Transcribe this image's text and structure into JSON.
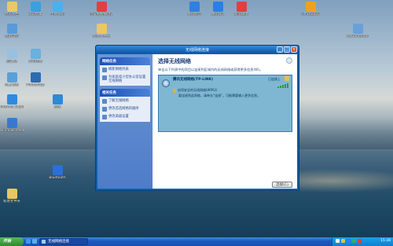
{
  "desktop": {
    "icons": [
      {
        "label": "我的文档",
        "color": "#e8c86a"
      },
      {
        "label": "360杀毒",
        "color": "#3aa0e0"
      },
      {
        "label": "上网导航",
        "color": "#4ab0f0"
      },
      {
        "label": "迅雷看看播放器",
        "color": "#e04040"
      },
      {
        "label": "暴风影音",
        "color": "#3080e0"
      },
      {
        "label": "腾讯QQ",
        "color": "#2a7ee8"
      },
      {
        "label": "新浪微博",
        "color": "#e04040"
      },
      {
        "label": "Office2007",
        "color": "#f0a020"
      },
      {
        "label": "我的电脑",
        "color": "#5a9ad8"
      },
      {
        "label": "新建文件夹",
        "color": "#e8c860"
      },
      {
        "label": "MyComputer",
        "color": "#6aa0d8"
      },
      {
        "label": "回收站",
        "color": "#9ac0e0"
      },
      {
        "label": "宽带连接",
        "color": "#6ab0e0"
      },
      {
        "label": "Internet Explorer",
        "color": "#2f8adf"
      },
      {
        "label": "网上邻居",
        "color": "#5aa0d8"
      },
      {
        "label": "Windows Media Player",
        "color": "#3a78d0"
      },
      {
        "label": "Photoshop",
        "color": "#2b6cb0"
      },
      {
        "label": "迅雷",
        "color": "#2c8ad8"
      },
      {
        "label": "新建文件夹",
        "color": "#e8c860"
      },
      {
        "label": "Bluetooth",
        "color": "#2a70d8"
      }
    ]
  },
  "window": {
    "title": "无线网络连接",
    "buttons": {
      "min": "_",
      "max": "□",
      "close": "×"
    },
    "sidebar": {
      "panels": [
        {
          "header": "网络任务",
          "items": [
            "刷新网络列表",
            "为家庭或小型办公室设置无线网络"
          ]
        },
        {
          "header": "相关任务",
          "items": [
            "了解无线网络",
            "更改首选网络的顺序",
            "更改高级设置"
          ]
        }
      ]
    },
    "main": {
      "heading": "选择无线网络",
      "description": "单击以下列表中的项目以连接到区域内的无线网络或获得更多信息(W)。",
      "network": {
        "name": "腾讯无线网络(TP-LINK)",
        "status": "已连接上",
        "security": "启用安全的无线网络(WPA2)",
        "sub": "要连接到此网络，请单击“连接”。可能需要输入更多信息。"
      },
      "connect_label": "连接(C)"
    }
  },
  "taskbar": {
    "start_label": "开始",
    "task_label": "无线网络连接",
    "clock": "15:38"
  }
}
